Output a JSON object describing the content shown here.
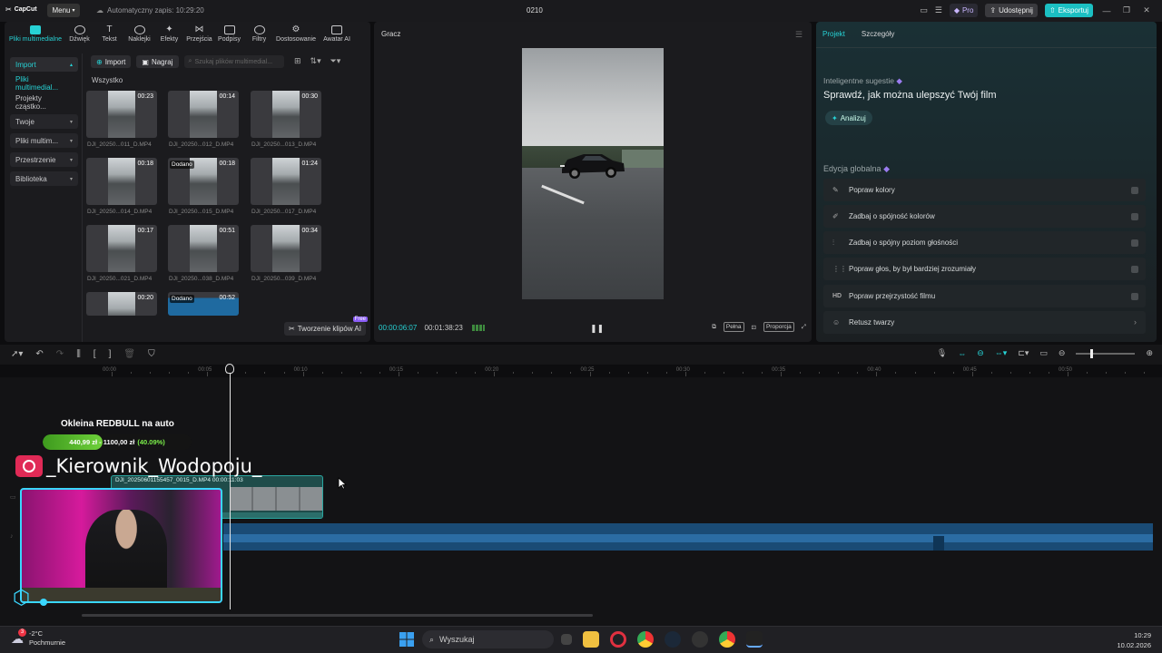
{
  "titlebar": {
    "logo": "CapCut",
    "menu_label": "Menu",
    "autosave": "Automatyczny zapis: 10:29:20",
    "project_name": "0210",
    "pro_label": "Pro",
    "share_label": "Udostępnij",
    "export_label": "Eksportuj"
  },
  "tools": [
    {
      "label": "Pliki multimedialne",
      "icon": "media-icon"
    },
    {
      "label": "Dźwięk",
      "icon": "audio-icon"
    },
    {
      "label": "Tekst",
      "icon": "text-icon"
    },
    {
      "label": "Naklejki",
      "icon": "sticker-icon"
    },
    {
      "label": "Efekty",
      "icon": "effects-icon"
    },
    {
      "label": "Przejścia",
      "icon": "transitions-icon"
    },
    {
      "label": "Podpisy",
      "icon": "captions-icon"
    },
    {
      "label": "Filtry",
      "icon": "filters-icon"
    },
    {
      "label": "Dostosowanie",
      "icon": "adjust-icon"
    },
    {
      "label": "Awatar AI",
      "icon": "avatar-icon"
    }
  ],
  "side_menu": [
    {
      "label": "Import"
    },
    {
      "label": "Pliki multimedial..."
    },
    {
      "label": "Projekty cząstko..."
    },
    {
      "label": "Twoje"
    },
    {
      "label": "Pliki multim..."
    },
    {
      "label": "Przestrzenie"
    },
    {
      "label": "Biblioteka"
    }
  ],
  "media": {
    "import_label": "Import",
    "record_label": "Nagraj",
    "search_placeholder": "Szukaj plików multimedial...",
    "section_label": "Wszystko",
    "items": [
      {
        "name": "DJI_20250...011_D.MP4",
        "duration": "00:23",
        "added": ""
      },
      {
        "name": "DJI_20250...012_D.MP4",
        "duration": "00:14",
        "added": ""
      },
      {
        "name": "DJI_20250...013_D.MP4",
        "duration": "00:30",
        "added": ""
      },
      {
        "name": "DJI_20250...014_D.MP4",
        "duration": "00:18",
        "added": ""
      },
      {
        "name": "DJI_20250...015_D.MP4",
        "duration": "00:18",
        "added": "Dodano"
      },
      {
        "name": "DJI_20250...017_D.MP4",
        "duration": "01:24",
        "added": ""
      },
      {
        "name": "DJI_20250...021_D.MP4",
        "duration": "00:17",
        "added": ""
      },
      {
        "name": "DJI_20250...038_D.MP4",
        "duration": "00:51",
        "added": ""
      },
      {
        "name": "DJI_20250...039_D.MP4",
        "duration": "00:34",
        "added": ""
      },
      {
        "name": "",
        "duration": "00:20",
        "added": ""
      },
      {
        "name": "",
        "duration": "00:52",
        "added": "Dodano"
      }
    ],
    "ai_clips_label": "Tworzenie klipów AI",
    "free_badge": "Free"
  },
  "player": {
    "title": "Gracz",
    "current_time": "00:00:06:07",
    "total_time": "00:01:38:23",
    "full_label": "Pełna",
    "ratio_label": "Proporcja"
  },
  "right_panel": {
    "tab_project": "Projekt",
    "tab_details": "Szczegóły",
    "smart_label": "Inteligentne sugestie",
    "smart_title": "Sprawdź, jak można ulepszyć Twój film",
    "analyze_label": "Analizuj",
    "global_label": "Edycja globalna",
    "global_items": [
      {
        "label": "Popraw kolory",
        "icon": "magic-wand-icon"
      },
      {
        "label": "Zadbaj o spójność kolorów",
        "icon": "color-match-icon"
      },
      {
        "label": "Zadbaj o spójny poziom głośności",
        "icon": "volume-levels-icon"
      },
      {
        "label": "Popraw głos, by był bardziej zrozumiały",
        "icon": "voice-enhance-icon"
      },
      {
        "label": "Popraw przejrzystość filmu",
        "icon": "hd-icon"
      },
      {
        "label": "Retusz twarzy",
        "icon": "face-retouch-icon"
      }
    ]
  },
  "ruler": [
    "00:00",
    "00:05",
    "00:10",
    "00:15",
    "00:20",
    "00:25",
    "00:30",
    "00:35",
    "00:40",
    "00:45",
    "00:50"
  ],
  "timeline": {
    "clip_label": "DJI_20250601155457_0015_D.MP4  00:00:11:03"
  },
  "overlay": {
    "goal_title": "Okleina REDBULL na auto",
    "goal_current": "440,99 zł",
    "goal_target": "1100,00 zł",
    "goal_percent": "(40.09%)",
    "goal_fraction": 0.4009,
    "instagram": "_Kierownik_Wodopoju_"
  },
  "taskbar": {
    "badge": "3",
    "temperature": "-2°C",
    "weather": "Pochmurnie",
    "search_label": "Wyszukaj",
    "time": "10:29",
    "date": "10.02.2026"
  },
  "colors": {
    "accent": "#27d2d5",
    "export": "#1bbfc2",
    "goal_green": "#6ed03a",
    "instagram": "#e02a56"
  }
}
